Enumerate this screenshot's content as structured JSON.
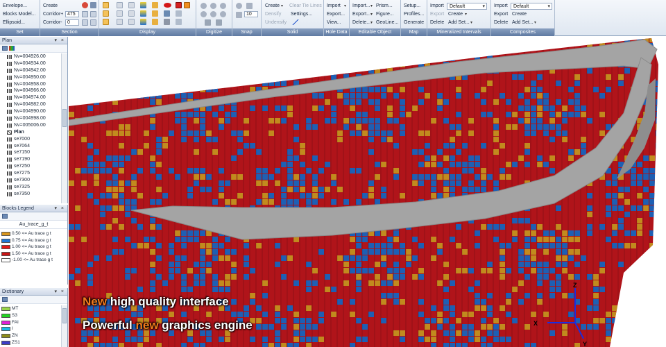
{
  "ribbon": {
    "set": {
      "label": "Set",
      "envelope": "Envelope...",
      "blocks_model": "Blocks Model...",
      "ellipsoid": "Ellipsoid..."
    },
    "section": {
      "label": "Section",
      "create": "Create",
      "corridor_plus": "Corridor+",
      "corridor_plus_value": "475",
      "corridor_minus": "Corridor-",
      "corridor_minus_value": "0"
    },
    "display": {
      "label": "Display"
    },
    "digitize": {
      "label": "Digitize"
    },
    "snap": {
      "label": "Snap",
      "snap_value": "10"
    },
    "solid": {
      "label": "Solid",
      "create": "Create",
      "clear_tie_lines": "Clear Tie Lines",
      "densify": "Densify",
      "settings": "Settings...",
      "undensify": "Undensify"
    },
    "hole_data": {
      "label": "Hole Data",
      "import": "Import",
      "export": "Export...",
      "view": "View..."
    },
    "editable_object": {
      "label": "Editable Object",
      "import": "Import...",
      "prism": "Prism...",
      "export": "Export...",
      "figure": "Figure...",
      "delete": "Delete...",
      "geoline": "GeoLine..."
    },
    "map": {
      "label": "Map",
      "setup": "Setup...",
      "profiles": "Profiles...",
      "generate": "Generate"
    },
    "mineralized_intervals": {
      "label": "Mineralized Intervals",
      "import": "Import",
      "combo_value": "Default",
      "export": "Export",
      "create": "Create",
      "delete": "Delete",
      "add_set": "Add Set..."
    },
    "composites": {
      "label": "Composites",
      "import": "Import",
      "combo_value": "Default",
      "export": "Export",
      "create": "Create",
      "delete": "Delete",
      "add_set": "Add Set..."
    }
  },
  "plan_panel": {
    "title": "Plan",
    "items": [
      "Nv=004926.00",
      "Nv=004934.00",
      "Nv=004942.00",
      "Nv=004950.00",
      "Nv=004958.00",
      "Nv=004966.00",
      "Nv=004974.00",
      "Nv=004982.00",
      "Nv=004990.00",
      "Nv=004998.00",
      "Nv=005006.00",
      "Plan",
      "se7000",
      "se7064",
      "se7150",
      "se7190",
      "se7250",
      "se7275",
      "se7300",
      "se7325",
      "se7350"
    ]
  },
  "legend_panel": {
    "title": "Blocks Legend",
    "header": "Au_trace_g_t",
    "rows": [
      {
        "label": "0.50 <= Au trace g t",
        "color": "#d8951c"
      },
      {
        "label": "0.75 <= Au trace g t",
        "color": "#1e78d8"
      },
      {
        "label": "1.00 <= Au trace g t",
        "color": "#e41a1a"
      },
      {
        "label": "1.50 <= Au trace g t",
        "color": "#c81414"
      },
      {
        "label": "-1.00 <= Au trace g t",
        "color": "#ffffff"
      }
    ]
  },
  "dictionary_panel": {
    "title": "Dictionary",
    "items": [
      {
        "label": "MT",
        "color": "#9ad64a"
      },
      {
        "label": "S3",
        "color": "#22d422"
      },
      {
        "label": "FAI",
        "color": "#e020d8"
      },
      {
        "label": "I",
        "color": "#18b8e8"
      },
      {
        "label": "ZN",
        "color": "#8c8c18"
      },
      {
        "label": "ZS1",
        "color": "#3c3cc8"
      }
    ]
  },
  "viewport": {
    "colors": {
      "high": "#b0141a",
      "mid": "#1e5fb4",
      "low": "#c28a1e",
      "pit": "#a4a4a4"
    },
    "caption_line1": {
      "highlight": "New",
      "rest": " high quality interface"
    },
    "caption_line2": {
      "before": "Powerful ",
      "highlight": "new",
      "after": " graphics engine"
    },
    "axes": {
      "x": "X",
      "y": "Y",
      "z": "Z"
    }
  }
}
